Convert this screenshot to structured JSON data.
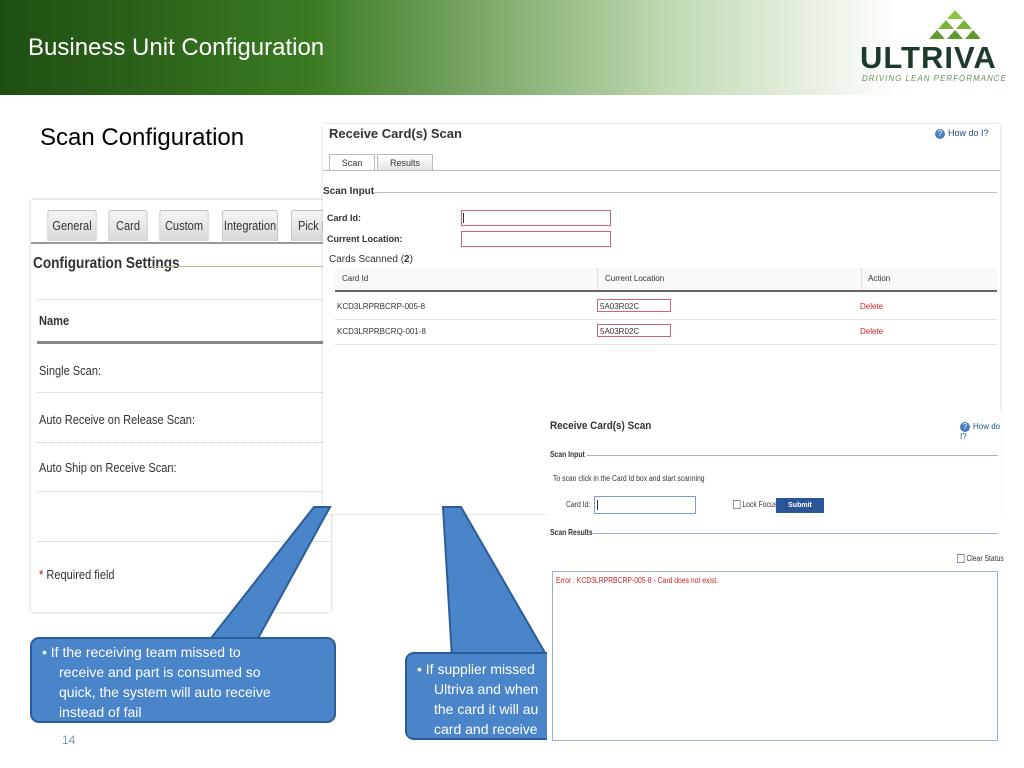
{
  "header": {
    "title": "Business Unit Configuration"
  },
  "logo": {
    "name": "ULTRIVA",
    "tagline": "DRIVING LEAN PERFORMANCE"
  },
  "section_heading": "Scan Configuration",
  "config_panel": {
    "tabs": [
      "General",
      "Card",
      "Custom",
      "Integration",
      "Pick L"
    ],
    "title": "Configuration Settings",
    "name_header": "Name",
    "rows": [
      "Single Scan:",
      "Auto Receive on Release Scan:",
      "Auto Ship on Receive Scan:"
    ],
    "required_star": "*",
    "required_label": "Required field"
  },
  "scan_window": {
    "title": "Receive Card(s) Scan",
    "how_do_i": "How do I?",
    "tabs": [
      "Scan",
      "Results"
    ],
    "scan_input": "Scan Input",
    "card_id_label": "Card Id:",
    "current_location_label": "Current Location:",
    "cards_scanned_prefix": "Cards Scanned (",
    "cards_scanned_count": "2",
    "cards_scanned_suffix": ")",
    "columns": [
      "Card Id",
      "Current Location",
      "Action"
    ],
    "rows": [
      {
        "card_id": "KCD3LRPRBCRP-005-8",
        "location": "5A03R02C",
        "action": "Delete"
      },
      {
        "card_id": "KCD3LRPRBCRQ-001-8",
        "location": "5A03R02C",
        "action": "Delete"
      }
    ]
  },
  "scan_window2": {
    "title": "Receive Card(s) Scan",
    "how_do_i": "How do I?",
    "scan_input": "Scan Input",
    "instructions": "To scan click in the Card Id box and start scanning",
    "card_id_label": "Card Id:",
    "lock_focus": "Lock Focus",
    "submit": "Submit",
    "scan_results": "Scan Results",
    "clear_status": "Clear Status",
    "error": "Error : KCD3LRPRBCRP-005-8 - Card does not exist."
  },
  "callouts": {
    "left": [
      "If the receiving team missed  to",
      "receive and part is consumed so",
      "quick, the system will auto receive",
      "instead of fail"
    ],
    "right": [
      "If supplier missed",
      "Ultriva  and when",
      "the card it will au",
      "card and receive"
    ]
  },
  "page_number": "14",
  "colors": {
    "bubble": "#4a84c9",
    "header_green": "#2e6b1a",
    "error_red": "#cc2222"
  }
}
